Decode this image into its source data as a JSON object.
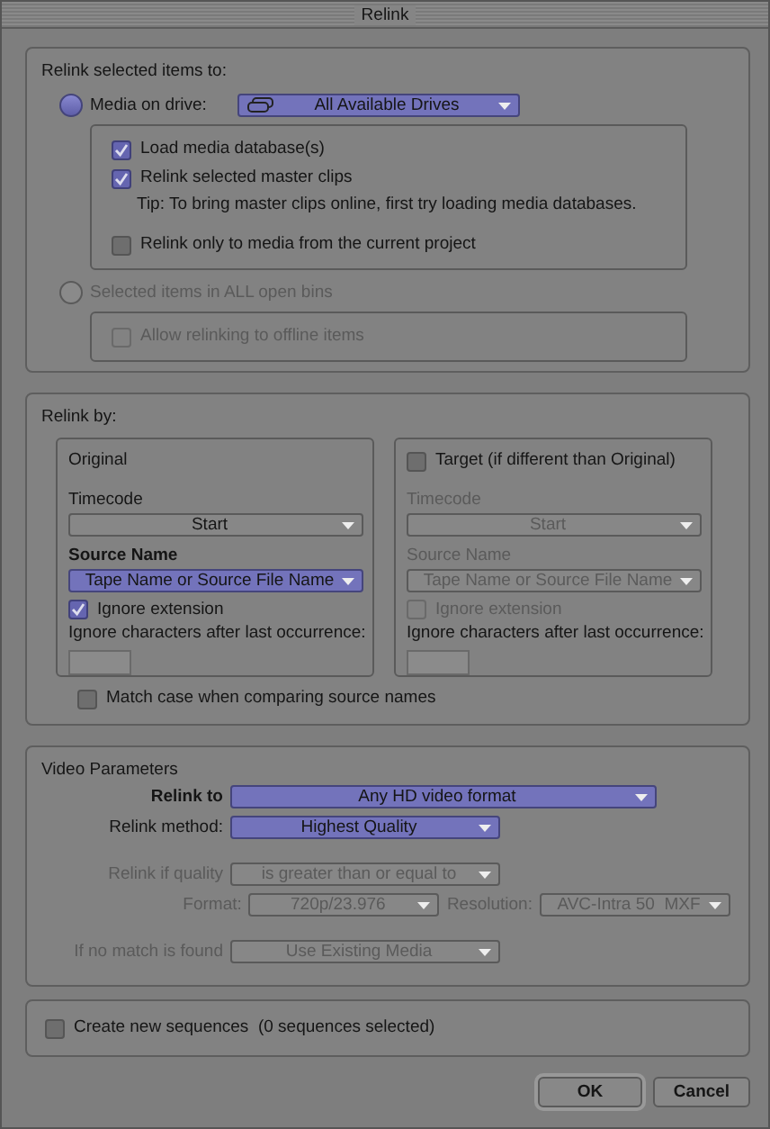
{
  "window": {
    "title": "Relink"
  },
  "relink_target": {
    "heading": "Relink selected items to:",
    "options": [
      {
        "label": "Media on drive:",
        "selected": true,
        "disabled": false,
        "dropdown": {
          "value": "All Available Drives",
          "highlighted": true
        },
        "items": [
          {
            "kind": "checkbox",
            "label": "Load media database(s)",
            "checked": true,
            "disabled": false
          },
          {
            "kind": "checkbox",
            "label": "Relink selected master clips",
            "checked": true,
            "disabled": false
          },
          {
            "kind": "tip",
            "label": "Tip: To bring master clips online, first try loading media databases."
          },
          {
            "kind": "checkbox",
            "label": "Relink only to media from the current project",
            "checked": false,
            "disabled": false
          }
        ]
      },
      {
        "label": "Selected items in ALL open bins",
        "selected": false,
        "disabled": true,
        "items": [
          {
            "kind": "checkbox",
            "label": "Allow relinking to offline items",
            "checked": false,
            "disabled": true
          }
        ]
      }
    ]
  },
  "relink_by": {
    "heading": "Relink by:",
    "columns": [
      {
        "kind": "label",
        "title": "Original",
        "disabled": false,
        "timecode_label": "Timecode",
        "timecode": {
          "value": "Start",
          "highlighted": false
        },
        "source_label": "Source Name",
        "source": {
          "value": "Tape Name or Source File Name",
          "highlighted": true
        },
        "ignore_extension": {
          "label": "Ignore extension",
          "checked": true
        },
        "ignore_chars_label": "Ignore characters after last occurrence:"
      },
      {
        "kind": "checkbox",
        "title": "Target (if different than Original)",
        "checked": false,
        "disabled": true,
        "timecode_label": "Timecode",
        "timecode": {
          "value": "Start",
          "highlighted": false
        },
        "source_label": "Source Name",
        "source": {
          "value": "Tape Name or Source File Name",
          "highlighted": false
        },
        "ignore_extension": {
          "label": "Ignore extension",
          "checked": false
        },
        "ignore_chars_label": "Ignore characters after last occurrence:"
      }
    ],
    "match_case": {
      "label": "Match case when comparing source names",
      "checked": false
    }
  },
  "video_parameters": {
    "heading": "Video Parameters",
    "rows": [
      {
        "kind": "wide",
        "label": "Relink to",
        "value": "Any HD video format",
        "highlighted": true,
        "disabled": false
      },
      {
        "kind": "select",
        "label": "Relink method:",
        "value": "Highest Quality",
        "highlighted": true,
        "disabled": false
      },
      {
        "kind": "select",
        "label": "Relink if quality",
        "value": "is greater than or equal to",
        "highlighted": false,
        "disabled": true
      },
      {
        "kind": "pair",
        "label": "Format:",
        "value": "720p/23.976",
        "label_2": "Resolution:",
        "value_2": "AVC-Intra 50  MXF",
        "highlighted": false,
        "disabled": true
      },
      {
        "kind": "select",
        "label": "If no match is found",
        "value": "Use Existing Media",
        "highlighted": false,
        "disabled": true
      }
    ]
  },
  "sequences": {
    "label": "Create new sequences  (0 sequences selected)",
    "checked": false
  },
  "buttons": [
    {
      "label": "OK",
      "default": true
    },
    {
      "label": "Cancel",
      "default": false
    }
  ]
}
